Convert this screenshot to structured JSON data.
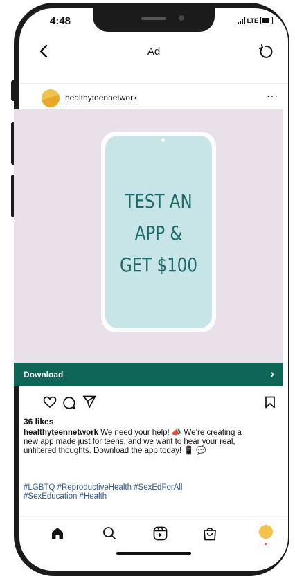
{
  "status_bar": {
    "time": "4:48",
    "network": "LTE"
  },
  "nav": {
    "back_label": "‹",
    "title": "Ad"
  },
  "post": {
    "username": "healthyteennetwork",
    "more_label": "···",
    "ad_creative": {
      "line1": "TEST AN",
      "line2": "APP &",
      "line3": "GET $100",
      "background_color": "#e9e0ea",
      "screen_color": "#c7e5e6",
      "text_color": "#1c6a69"
    },
    "cta": {
      "label": "Download",
      "chevron": "›",
      "color": "#0f6556"
    },
    "likes": "36 likes",
    "caption": {
      "username": "healthyteennetwork",
      "text": " We need your help! 📣 We’re creating a new app made just for teens, and we want to hear your real, unfiltered thoughts. Download the app today! 📱 💬"
    },
    "hashtags": "#LGBTQ #ReproductiveHealth #SexEdForAll #SexEducation #Health"
  },
  "icons": {
    "actions": [
      "heart-icon",
      "comment-icon",
      "share-icon",
      "bookmark-icon"
    ],
    "tabs": [
      "home-icon",
      "search-icon",
      "reels-icon",
      "shop-icon",
      "profile-avatar"
    ]
  }
}
